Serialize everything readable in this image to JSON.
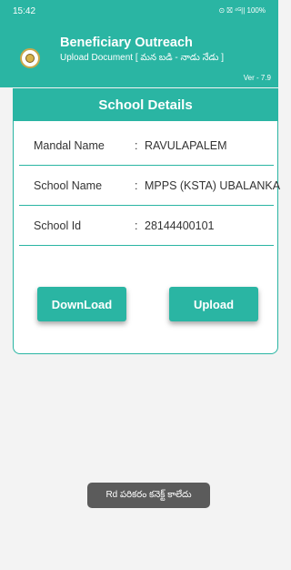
{
  "status_bar": {
    "time": "15:42",
    "indicators": "⊙ ⛝ ⁴ᴳ|| 100%"
  },
  "app_bar": {
    "title": "Beneficiary Outreach",
    "subtitle": "Upload Document [ మన బడి - నాడు నేడు ]",
    "version": "Ver - 7.9",
    "logo_icon": "ap-govt-emblem-icon"
  },
  "card": {
    "title": "School Details",
    "rows": [
      {
        "label": "Mandal Name",
        "value": "RAVULAPALEM"
      },
      {
        "label": "School Name",
        "value": "MPPS (KSTA) UBALANKA"
      },
      {
        "label": "School Id",
        "value": "28144400101"
      }
    ],
    "colon": ":",
    "buttons": {
      "download": "DownLoad",
      "upload": "Upload"
    }
  },
  "toast": "Rd పరికరం కనెక్ట్ కాలేదు",
  "colors": {
    "primary": "#2ab5a3",
    "background": "#f3f3f3",
    "toast": "#5b5b5b"
  }
}
